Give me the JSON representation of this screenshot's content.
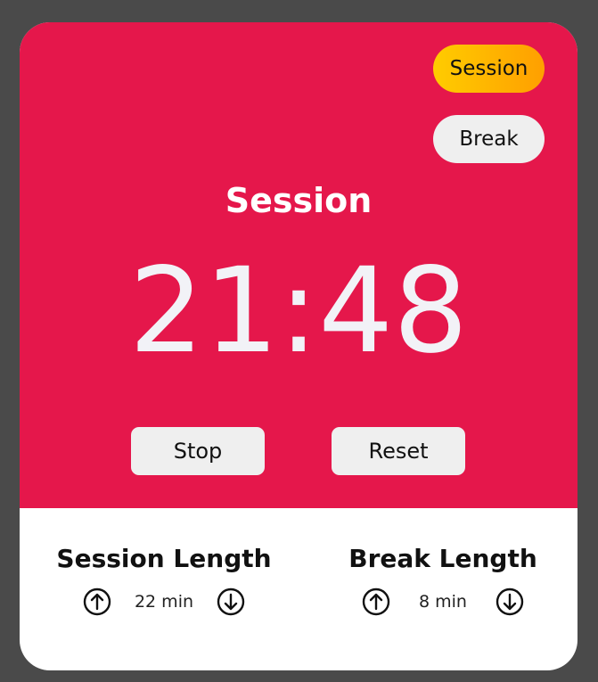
{
  "mode_buttons": {
    "session": "Session",
    "break": "Break"
  },
  "timer": {
    "label": "Session",
    "time": "21:48"
  },
  "controls": {
    "stop": "Stop",
    "reset": "Reset"
  },
  "session_length": {
    "title": "Session Length",
    "value": "22 min"
  },
  "break_length": {
    "title": "Break Length",
    "value": "8 min"
  },
  "colors": {
    "background": "#4a4a4a",
    "panel_top": "#e5174b",
    "session_btn_from": "#ffcc00",
    "session_btn_to": "#ff9f00",
    "button_gray": "#efefef"
  },
  "icons": {
    "increase": "arrow-up-circle-icon",
    "decrease": "arrow-down-circle-icon"
  }
}
